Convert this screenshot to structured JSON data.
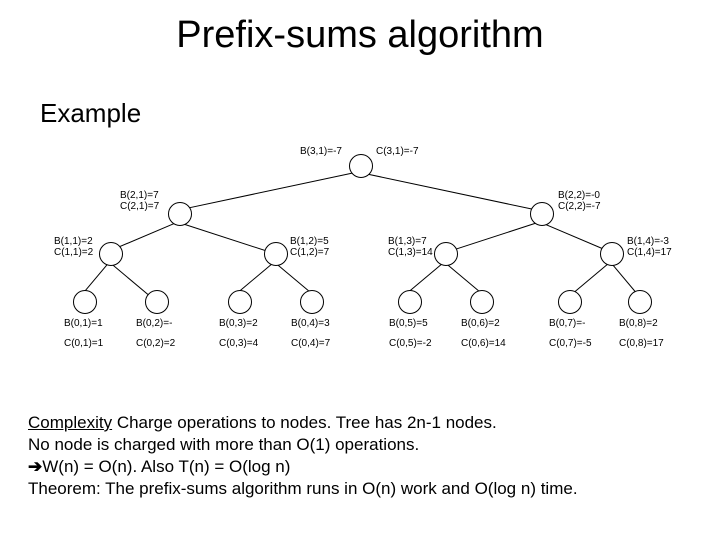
{
  "title": "Prefix-sums algorithm",
  "subtitle": "Example",
  "tree": {
    "root": {
      "b_label": "B(3,1)=-7",
      "c_label": "C(3,1)=-7"
    },
    "level2": [
      {
        "b": "B(2,1)=7",
        "c": "C(2,1)=7"
      },
      {
        "b": "B(2,2)=-0",
        "c": "C(2,2)=-7"
      }
    ],
    "level1": [
      {
        "b": "B(1,1)=2",
        "c": "C(1,1)=2"
      },
      {
        "b": "B(1,2)=5",
        "c": "C(1,2)=7"
      },
      {
        "b": "B(1,3)=7",
        "c": "C(1,3)=14"
      },
      {
        "b": "B(1,4)=-3",
        "c": "C(1,4)=17"
      }
    ],
    "level0": [
      {
        "b": "B(0,1)=1",
        "c": "C(0,1)=1"
      },
      {
        "b": "B(0,2)=-",
        "c": "C(0,2)=2"
      },
      {
        "b": "B(0,3)=2",
        "c": "C(0,3)=4"
      },
      {
        "b": "B(0,4)=3",
        "c": "C(0,4)=7"
      },
      {
        "b": "B(0,5)=5",
        "c": "C(0,5)=-2"
      },
      {
        "b": "B(0,6)=2",
        "c": "C(0,6)=14"
      },
      {
        "b": "B(0,7)=-",
        "c": "C(0,7)=-5"
      },
      {
        "b": "B(0,8)=2",
        "c": "C(0,8)=17"
      }
    ]
  },
  "complexity": {
    "label": "Complexity",
    "line1_rest": " Charge operations to nodes. Tree has 2n-1 nodes.",
    "line2": "No node is charged with more than O(1) operations.",
    "line3_arrow": "➔",
    "line3_rest": "W(n) = O(n). Also T(n) = O(log n)",
    "line4": "Theorem: The prefix-sums algorithm runs in O(n) work and O(log n) time."
  }
}
